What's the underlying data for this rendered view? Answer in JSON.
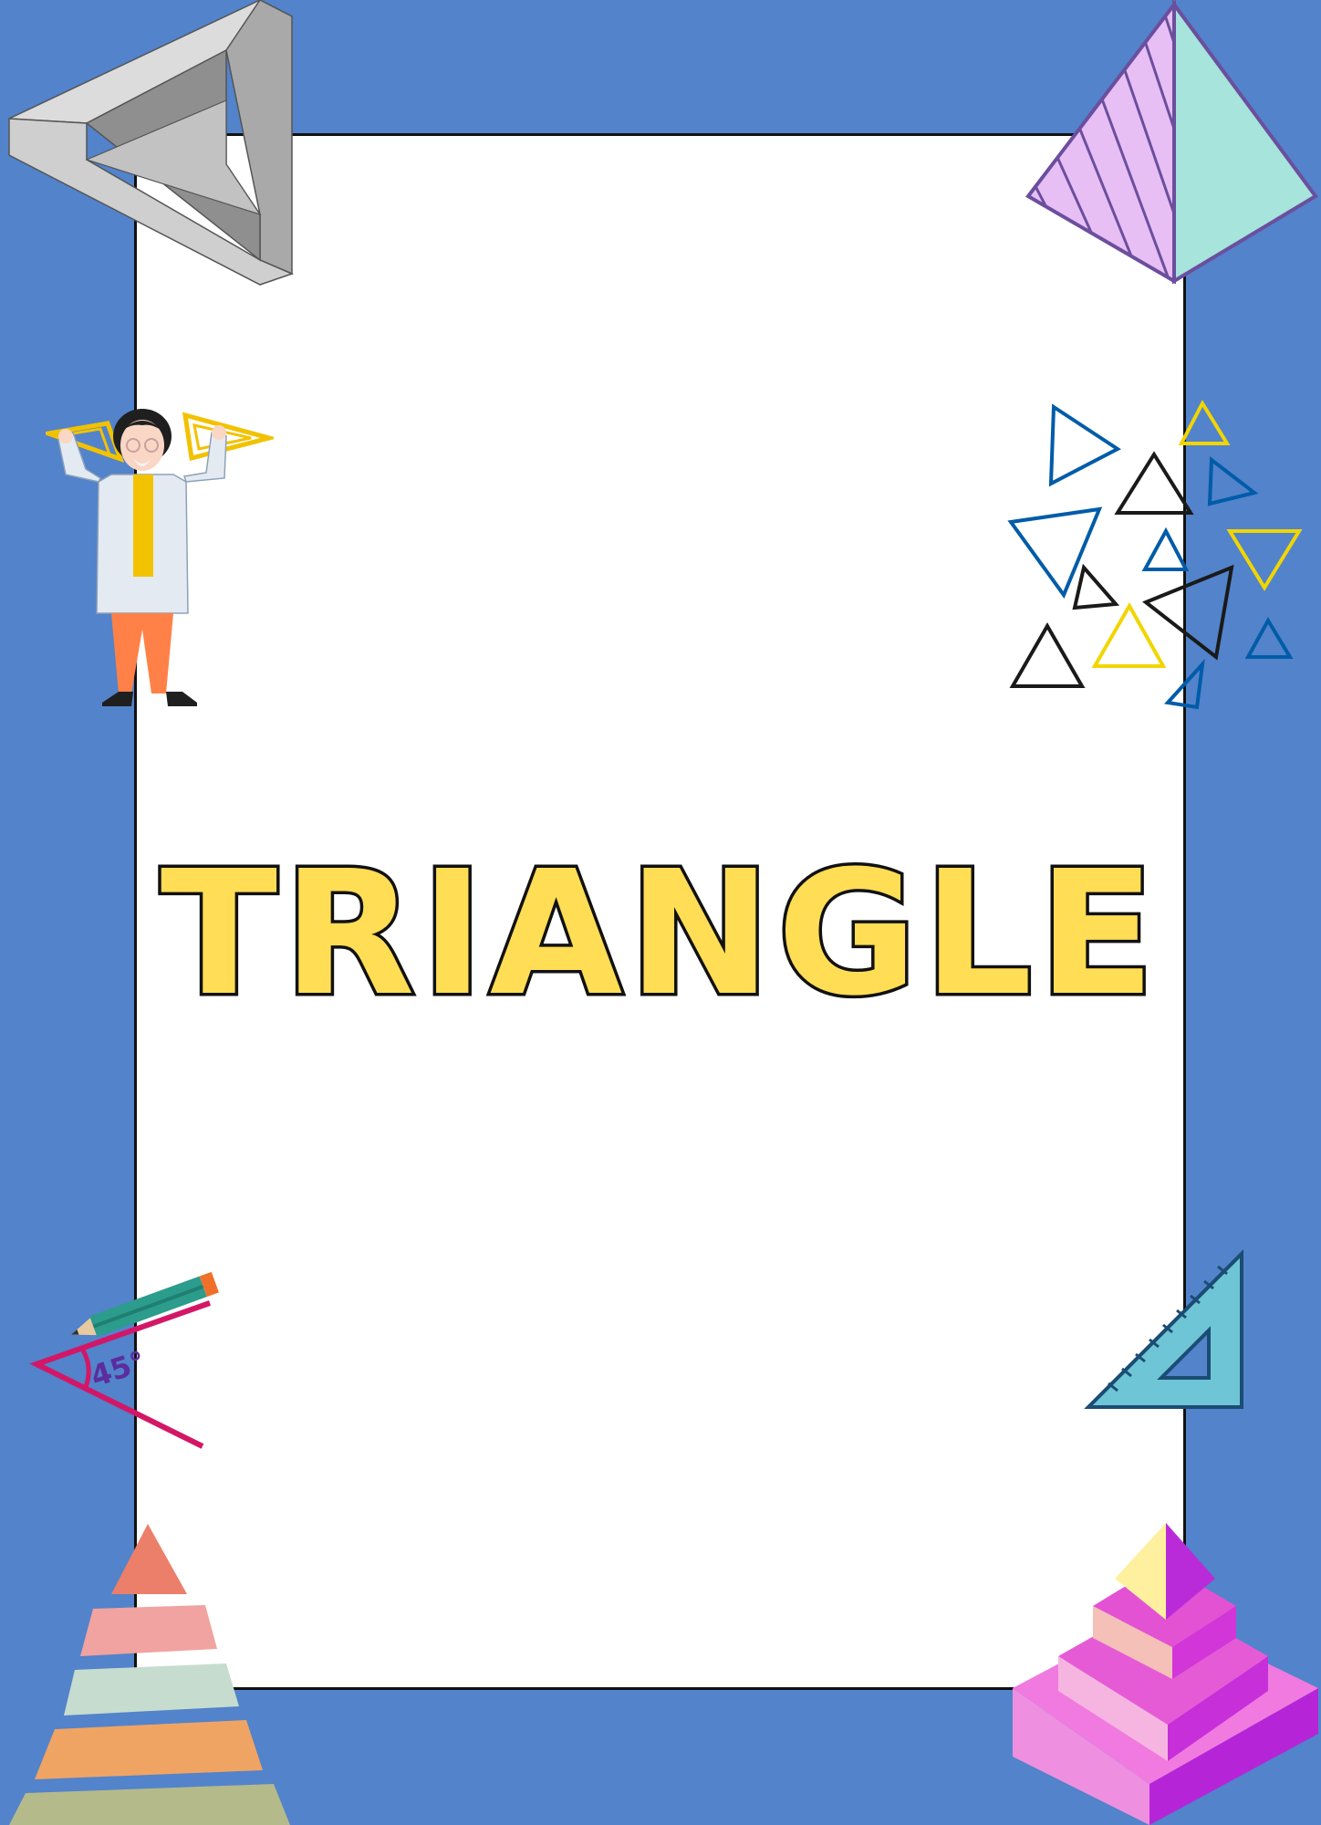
{
  "poster": {
    "title": "TRIANGLE",
    "angle_label": "45°"
  },
  "colors": {
    "background": "#5283CB",
    "card": "#FFFFFF",
    "title_fill": "#FFDD55",
    "title_outline": "#111111"
  },
  "decorations": [
    "impossible-triangle-icon",
    "pyramid-icon",
    "scientist-holding-triangles-illustration",
    "triangle-cluster-icon",
    "pencil-protractor-angle-icon",
    "set-square-ruler-icon",
    "stacked-pyramid-icon",
    "layered-3d-pyramid-icon"
  ]
}
